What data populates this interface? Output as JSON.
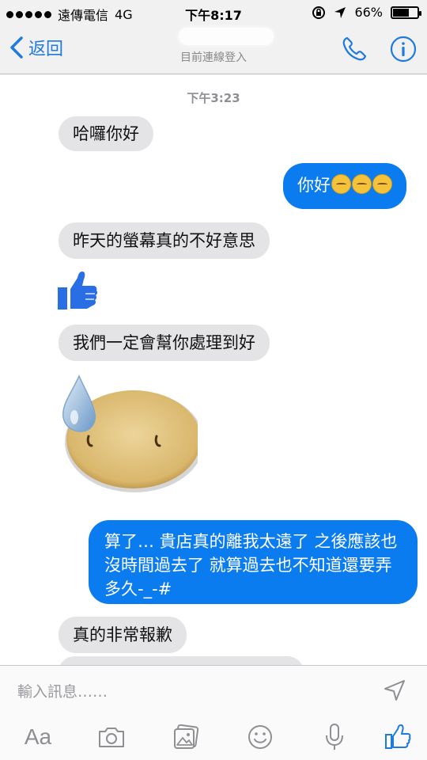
{
  "status_bar": {
    "carrier": "遠傳電信",
    "network": "4G",
    "time": "下午8:17",
    "battery": "66%",
    "battery_level": 0.66
  },
  "nav": {
    "back_label": "返回",
    "subtitle": "目前連線登入"
  },
  "chat": {
    "timestamp": "下午3:23",
    "messages": [
      {
        "direction": "in",
        "text": "哈囉你好"
      },
      {
        "direction": "out",
        "text": "你好"
      },
      {
        "direction": "in",
        "text": "昨天的螢幕真的不好意思"
      },
      {
        "direction": "in",
        "sticker": "thumbs-up-icon"
      },
      {
        "direction": "in",
        "text": "我們一定會幫你處理到好"
      },
      {
        "direction": "in",
        "sticker": "sweat-face-sticker"
      },
      {
        "direction": "out",
        "text": "算了… 貴店真的離我太遠了 之後應該也沒時間過去了 就算過去也不知道還要弄多久-_-#"
      },
      {
        "direction": "in",
        "text": "真的非常報歉"
      }
    ]
  },
  "composer": {
    "placeholder": "輸入訊息……",
    "aa_label": "Aa",
    "tools": [
      "text-format-icon",
      "camera-icon",
      "photo-icon",
      "emoji-icon",
      "microphone-icon",
      "thumbs-up-icon"
    ]
  },
  "colors": {
    "accent": "#1f7ae0",
    "outgoing_bubble": "#0a7cf0",
    "incoming_bubble": "#e4e4e6"
  }
}
